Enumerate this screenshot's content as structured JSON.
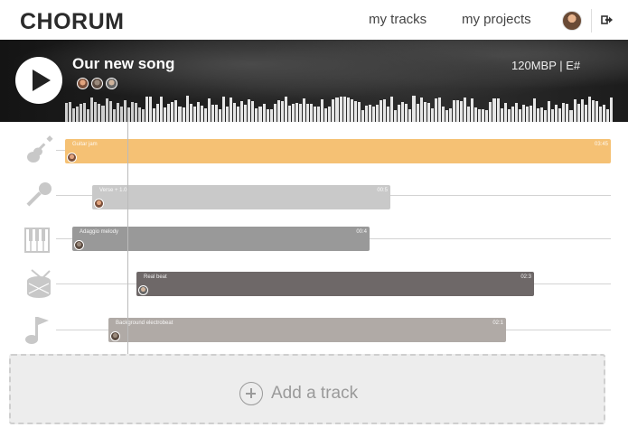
{
  "app": {
    "logo": "CHORUM"
  },
  "nav": {
    "tracks": "my tracks",
    "projects": "my projects"
  },
  "song": {
    "title": "Our new song",
    "meta": "120MBP | E#",
    "collaborator_count": 3
  },
  "tracks": [
    {
      "instrument": "guitar-icon",
      "name": "Guitar jam",
      "duration": "03:45",
      "color": "#f5c174"
    },
    {
      "instrument": "microphone-icon",
      "name": "Verse + 1.0",
      "duration": "00:5",
      "color": "#c9c9c9"
    },
    {
      "instrument": "piano-icon",
      "name": "Adaggio melody",
      "duration": "00:4",
      "color": "#999999"
    },
    {
      "instrument": "drum-icon",
      "name": "Real beat",
      "duration": "02:3",
      "color": "#6e6868"
    },
    {
      "instrument": "music-note-icon",
      "name": "Background electrobeat",
      "duration": "02:1",
      "color": "#b0aaa6"
    }
  ],
  "add_track": {
    "label": "Add a track"
  }
}
